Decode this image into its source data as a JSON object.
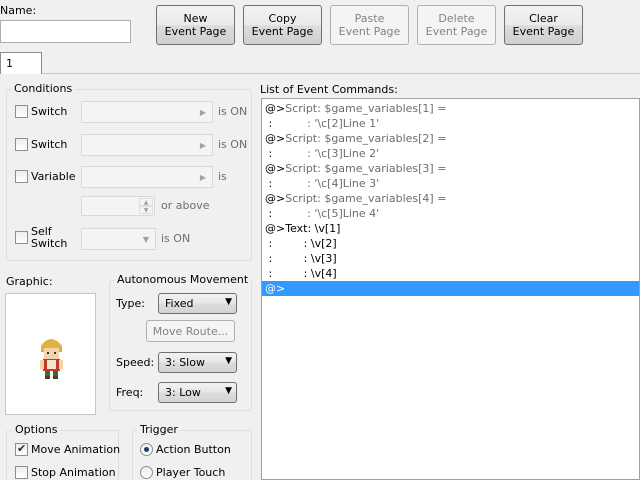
{
  "header": {
    "name_label": "Name:",
    "name_value": "",
    "buttons": [
      {
        "line1": "New",
        "line2": "Event Page",
        "enabled": true
      },
      {
        "line1": "Copy",
        "line2": "Event Page",
        "enabled": true
      },
      {
        "line1": "Paste",
        "line2": "Event Page",
        "enabled": false
      },
      {
        "line1": "Delete",
        "line2": "Event Page",
        "enabled": false
      },
      {
        "line1": "Clear",
        "line2": "Event Page",
        "enabled": true
      }
    ]
  },
  "tabs": [
    {
      "label": "1",
      "selected": true
    }
  ],
  "conditions": {
    "title": "Conditions",
    "switch1_label": "Switch",
    "switch1_suffix": "is ON",
    "switch2_label": "Switch",
    "switch2_suffix": "is ON",
    "variable_label": "Variable",
    "variable_suffix": "is",
    "above_suffix": "or above",
    "self_switch_label_1": "Self",
    "self_switch_label_2": "Switch",
    "self_switch_suffix": "is ON"
  },
  "graphic": {
    "label": "Graphic:"
  },
  "autonomous": {
    "title": "Autonomous Movement",
    "type_label": "Type:",
    "type_value": "Fixed",
    "move_route_label": "Move Route...",
    "speed_label": "Speed:",
    "speed_value": "3: Slow",
    "freq_label": "Freq:",
    "freq_value": "3: Low"
  },
  "options": {
    "title": "Options",
    "move_animation": {
      "label": "Move Animation",
      "checked": true
    },
    "stop_animation": {
      "label": "Stop Animation",
      "checked": false
    }
  },
  "trigger": {
    "title": "Trigger",
    "action_button": {
      "label": "Action Button",
      "checked": true
    },
    "player_touch": {
      "label": "Player Touch",
      "checked": false
    }
  },
  "event_list": {
    "label": "List of Event Commands:",
    "lines": [
      {
        "prefix": "@>",
        "text": "Script: $game_variables[1] =",
        "grey": true
      },
      {
        "prefix": " :",
        "text": "          : '\\c[2]Line 1'",
        "grey": true
      },
      {
        "prefix": "@>",
        "text": "Script: $game_variables[2] =",
        "grey": true
      },
      {
        "prefix": " :",
        "text": "          : '\\c[3]Line 2'",
        "grey": true
      },
      {
        "prefix": "@>",
        "text": "Script: $game_variables[3] =",
        "grey": true
      },
      {
        "prefix": " :",
        "text": "          : '\\c[4]Line 3'",
        "grey": true
      },
      {
        "prefix": "@>",
        "text": "Script: $game_variables[4] =",
        "grey": true
      },
      {
        "prefix": " :",
        "text": "          : '\\c[5]Line 4'",
        "grey": true
      },
      {
        "prefix": "@>",
        "text": "Text: \\v[1]",
        "grey": false
      },
      {
        "prefix": " :",
        "text": "         : \\v[2]",
        "grey": false
      },
      {
        "prefix": " :",
        "text": "         : \\v[3]",
        "grey": false
      },
      {
        "prefix": " :",
        "text": "         : \\v[4]",
        "grey": false
      },
      {
        "prefix": "@>",
        "text": "",
        "grey": false,
        "selected": true
      }
    ]
  }
}
